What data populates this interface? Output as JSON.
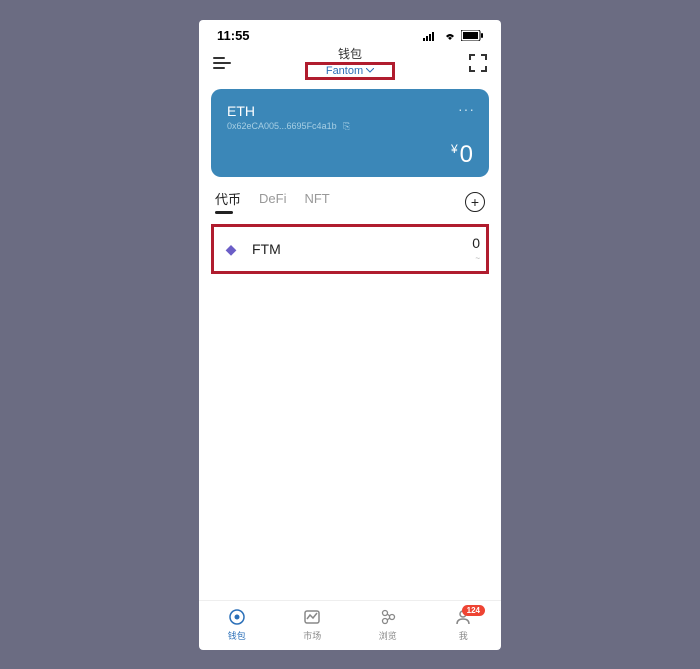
{
  "status": {
    "time": "11:55"
  },
  "header": {
    "title": "钱包",
    "network": "Fantom"
  },
  "card": {
    "symbol": "ETH",
    "address": "0x62eCA005...6695Fc4a1b",
    "currency": "¥",
    "amount": "0",
    "copy_icon": "copy-icon",
    "more": "···"
  },
  "tabs": [
    {
      "label": "代币",
      "active": true
    },
    {
      "label": "DeFi",
      "active": false
    },
    {
      "label": "NFT",
      "active": false
    }
  ],
  "tokens": [
    {
      "icon": "◆",
      "name": "FTM",
      "balance": "0",
      "sub": "~"
    }
  ],
  "nav": [
    {
      "label": "钱包",
      "active": true
    },
    {
      "label": "市场",
      "active": false
    },
    {
      "label": "浏览",
      "active": false
    },
    {
      "label": "我",
      "active": false,
      "badge": "124"
    }
  ],
  "colors": {
    "accent": "#2a6fb8",
    "card": "#3b87b8",
    "highlight": "#b01c2e"
  }
}
